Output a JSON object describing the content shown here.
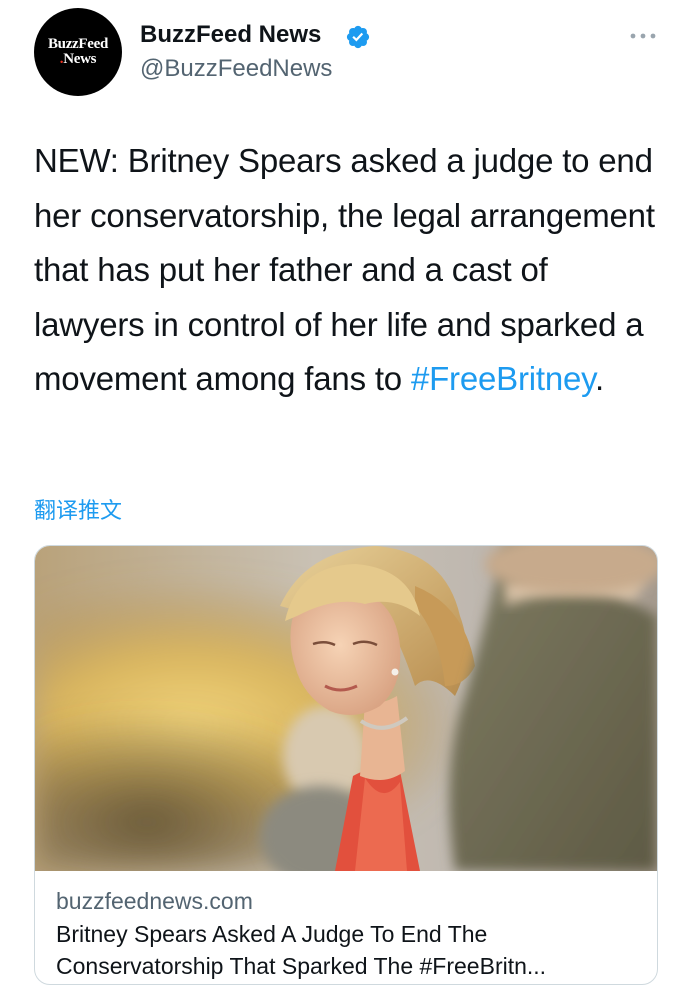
{
  "author": {
    "display_name": "BuzzFeed News",
    "handle": "@BuzzFeedNews",
    "avatar_logo": {
      "line1": "BuzzFeed",
      "line2_dot": ".",
      "line2": "News"
    },
    "verified": true
  },
  "tweet": {
    "text_before": "NEW: Britney Spears asked a judge to end her conservatorship, the legal arrangement that has put her father and a cast of lawyers in control of her life and sparked a movement among fans to ",
    "hashtag": "#FreeBritney",
    "text_after": "."
  },
  "translate_label": "翻译推文",
  "link_card": {
    "domain": "buzzfeednews.com",
    "title_line1": "Britney Spears Asked A Judge To End The",
    "title_line2": "Conservatorship That Sparked The #FreeBritn..."
  },
  "colors": {
    "link_blue": "#1d9bf0",
    "text_primary": "#0f1419",
    "text_secondary": "#536471",
    "verified_badge": "#1d9bf0"
  },
  "icons": {
    "verified": "verified-badge-icon",
    "more": "more-dots-icon"
  }
}
